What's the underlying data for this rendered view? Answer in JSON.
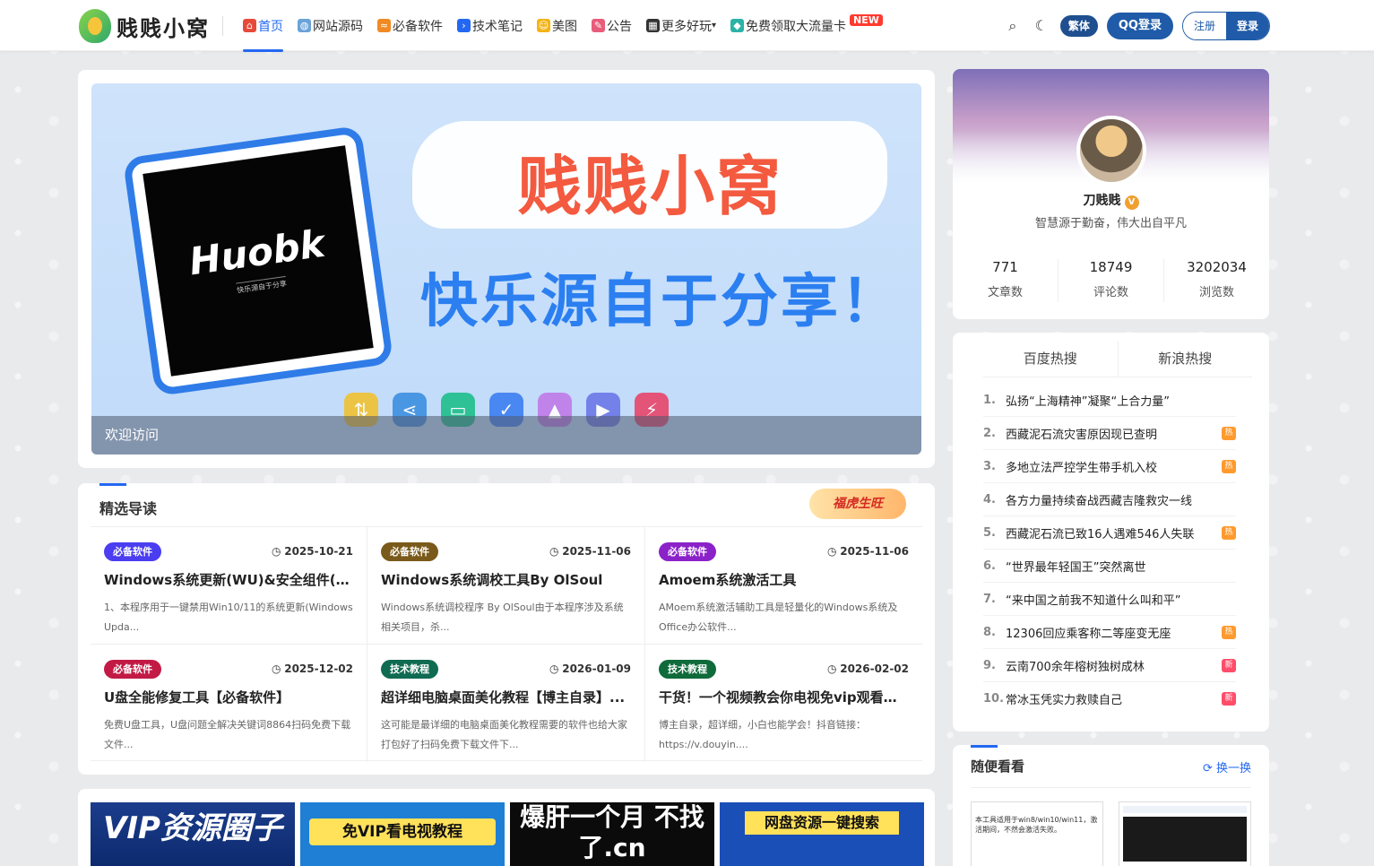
{
  "site": {
    "logo_text": "贱贱小窝"
  },
  "nav": {
    "items": [
      {
        "label": "首页",
        "active": true,
        "icon": "home-icon",
        "color": "#e64a3b"
      },
      {
        "label": "网站源码",
        "icon": "globe-icon",
        "color": "#6aa3d8"
      },
      {
        "label": "必备软件",
        "icon": "software-icon",
        "color": "#f08a24"
      },
      {
        "label": "技术笔记",
        "icon": "code-icon",
        "color": "#2468f2"
      },
      {
        "label": "美图",
        "icon": "smile-icon",
        "color": "#f3b416"
      },
      {
        "label": "公告",
        "icon": "pencil-icon",
        "color": "#e85c7a"
      },
      {
        "label": "更多好玩",
        "icon": "grid-icon",
        "color": "#333333"
      },
      {
        "label": "免费领取大流量卡",
        "icon": "diamond-icon",
        "color": "#2ab3a6"
      }
    ],
    "new_badge": "NEW"
  },
  "header": {
    "traditional_label": "繁体",
    "qq_login_label": "QQ登录",
    "register_label": "注册",
    "login_label": "登录"
  },
  "banner": {
    "tablet_title": "Huobk",
    "tablet_subtitle": "快乐源自于分享",
    "title": "贱贱小窝",
    "slogan": "快乐源自于分享！",
    "caption": "欢迎访问"
  },
  "featured": {
    "title": "精选导读",
    "deco_text": "福虎生旺",
    "items": [
      {
        "tag": "必备软件",
        "tag_color": "#4b3df0",
        "date": "2025-10-21",
        "title": "Windows系统更新(WU)&安全组件(W...",
        "desc": "1、本程序用于一键禁用Win10/11的系统更新(Windows Upda..."
      },
      {
        "tag": "必备软件",
        "tag_color": "#7a5a1a",
        "date": "2025-11-06",
        "title": "Windows系统调校工具By OlSoul",
        "desc": "Windows系统调校程序 By OlSoul由于本程序涉及系统相关项目，杀..."
      },
      {
        "tag": "必备软件",
        "tag_color": "#8b22c9",
        "date": "2025-11-06",
        "title": "Amoem系统激活工具",
        "desc": "AMoem系统激活辅助工具是轻量化的Windows系统及Office办公软件..."
      },
      {
        "tag": "必备软件",
        "tag_color": "#c21a45",
        "date": "2025-12-02",
        "title": "U盘全能修复工具【必备软件】",
        "desc": "免费U盘工具，U盘问题全解决关键词8864扫码免费下载文件..."
      },
      {
        "tag": "技术教程",
        "tag_color": "#0f6b52",
        "date": "2026-01-09",
        "title": "超详细电脑桌面美化教程【博主自录】...",
        "desc": "这可能是最详细的电脑桌面美化教程需要的软件也给大家打包好了扫码免费下载文件下..."
      },
      {
        "tag": "技术教程",
        "tag_color": "#0f6b3a",
        "date": "2026-02-02",
        "title": "干货！一个视频教会你电视免vip观看影...",
        "desc": "博主自录，超详细，小白也能学会！抖音链接：https://v.douyin...."
      }
    ]
  },
  "ads": [
    {
      "text": "VIP资源圈子"
    },
    {
      "text": "免VIP看电视教程"
    },
    {
      "text": "爆肝一个月 不找了.cn"
    },
    {
      "text": "网盘资源一键搜索"
    }
  ],
  "profile": {
    "name": "刀贱贱",
    "badge": "V",
    "motto": "智慧源于勤奋，伟大出自平凡",
    "stats": [
      {
        "value": "771",
        "label": "文章数"
      },
      {
        "value": "18749",
        "label": "评论数"
      },
      {
        "value": "3202034",
        "label": "浏览数"
      }
    ]
  },
  "hot": {
    "tabs": [
      "百度热搜",
      "新浪热搜"
    ],
    "items": [
      {
        "rank": "1.",
        "text": "弘扬“上海精神”凝聚“上合力量”",
        "badge": ""
      },
      {
        "rank": "2.",
        "text": "西藏泥石流灾害原因现已查明",
        "badge": "热"
      },
      {
        "rank": "3.",
        "text": "多地立法严控学生带手机入校",
        "badge": "热"
      },
      {
        "rank": "4.",
        "text": "各方力量持续奋战西藏吉隆救灾一线",
        "badge": ""
      },
      {
        "rank": "5.",
        "text": "西藏泥石流已致16人遇难546人失联",
        "badge": "热"
      },
      {
        "rank": "6.",
        "text": "“世界最年轻国王”突然离世",
        "badge": ""
      },
      {
        "rank": "7.",
        "text": "“来中国之前我不知道什么叫和平”",
        "badge": ""
      },
      {
        "rank": "8.",
        "text": "12306回应乘客称二等座变无座",
        "badge": "热"
      },
      {
        "rank": "9.",
        "text": "云南700余年榕树独树成林",
        "badge": "新"
      },
      {
        "rank": "10.",
        "text": "常冰玉凭实力救赎自己",
        "badge": "新"
      }
    ]
  },
  "random": {
    "title": "随便看看",
    "refresh_label": "换一换",
    "thumb1_text": "本工具适用于win8/win10/win11，激活期间，不然会激活失败。"
  }
}
